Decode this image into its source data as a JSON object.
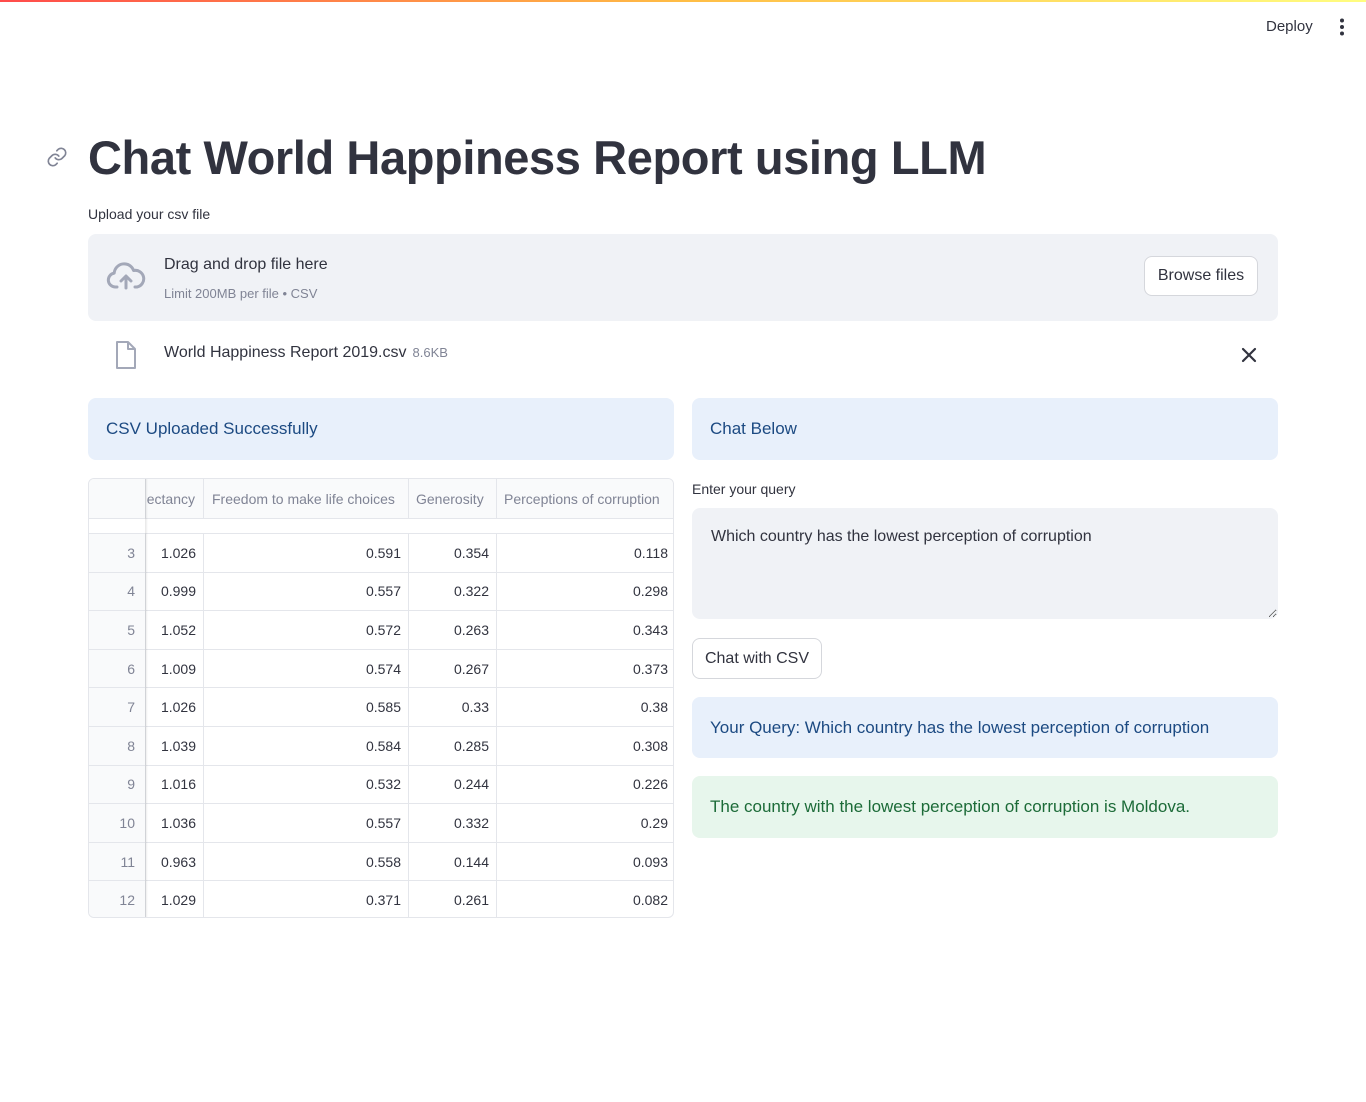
{
  "header": {
    "deploy_label": "Deploy"
  },
  "page": {
    "title": "Chat World Happiness Report using LLM"
  },
  "uploader": {
    "label": "Upload your csv file",
    "drop_title": "Drag and drop file here",
    "drop_subtitle": "Limit 200MB per file • CSV",
    "browse_label": "Browse files"
  },
  "file": {
    "name": "World Happiness Report 2019.csv",
    "size": "8.6KB"
  },
  "left": {
    "status": "CSV Uploaded Successfully"
  },
  "table": {
    "columns": [
      "ectancy",
      "Freedom to make life choices",
      "Generosity",
      "Perceptions of corruption"
    ],
    "rows": [
      {
        "idx": "3",
        "cells": [
          "1.026",
          "0.591",
          "0.354",
          "0.118"
        ]
      },
      {
        "idx": "4",
        "cells": [
          "0.999",
          "0.557",
          "0.322",
          "0.298"
        ]
      },
      {
        "idx": "5",
        "cells": [
          "1.052",
          "0.572",
          "0.263",
          "0.343"
        ]
      },
      {
        "idx": "6",
        "cells": [
          "1.009",
          "0.574",
          "0.267",
          "0.373"
        ]
      },
      {
        "idx": "7",
        "cells": [
          "1.026",
          "0.585",
          "0.33",
          "0.38"
        ]
      },
      {
        "idx": "8",
        "cells": [
          "1.039",
          "0.584",
          "0.285",
          "0.308"
        ]
      },
      {
        "idx": "9",
        "cells": [
          "1.016",
          "0.532",
          "0.244",
          "0.226"
        ]
      },
      {
        "idx": "10",
        "cells": [
          "1.036",
          "0.557",
          "0.332",
          "0.29"
        ]
      },
      {
        "idx": "11",
        "cells": [
          "0.963",
          "0.558",
          "0.144",
          "0.093"
        ]
      },
      {
        "idx": "12",
        "cells": [
          "1.029",
          "0.371",
          "0.261",
          "0.082"
        ]
      }
    ]
  },
  "right": {
    "status": "Chat Below",
    "query_label": "Enter your query",
    "query_value": "Which country has the lowest perception of corruption",
    "chat_button": "Chat with CSV",
    "query_echo": "Your Query: Which country has the lowest perception of corruption",
    "answer": "The country with the lowest perception of corruption is Moldova."
  },
  "colors": {
    "info_bg": "#e8f0fb",
    "info_text": "#1c4a82",
    "success_bg": "#e7f6ec",
    "success_text": "#1c6b38",
    "accent": "#ff4b4b"
  },
  "icons": {
    "menu": "more-vertical-icon",
    "link": "link-icon",
    "upload": "cloud-upload-icon",
    "file": "file-icon",
    "close": "close-icon"
  }
}
